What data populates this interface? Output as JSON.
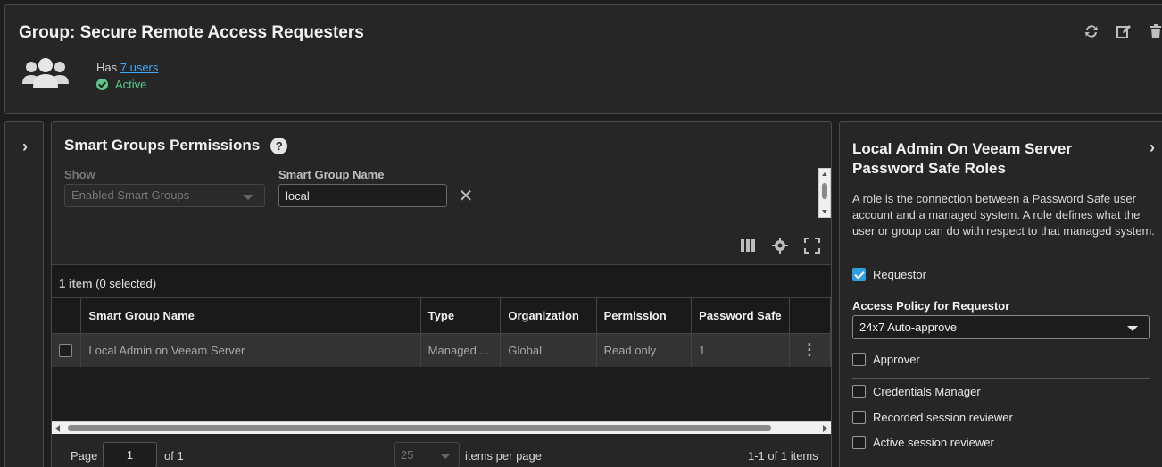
{
  "header": {
    "title": "Group: Secure Remote Access Requesters",
    "has_prefix": "Has",
    "users_link": "7 users",
    "status": "Active",
    "actions": [
      {
        "icon": "refresh-icon"
      },
      {
        "icon": "edit-icon"
      },
      {
        "icon": "trash-icon"
      }
    ]
  },
  "permissions": {
    "title": "Smart Groups Permissions",
    "show_label": "Show",
    "show_value": "Enabled Smart Groups",
    "name_label": "Smart Group Name",
    "name_value": "local",
    "count_bold": "1 item",
    "count_rest": " (0 selected)",
    "columns": [
      "Smart Group Name",
      "Type",
      "Organization",
      "Permission",
      "Password Safe"
    ],
    "rows": [
      {
        "name": "Local Admin on Veeam Server",
        "type": "Managed ...",
        "organization": "Global",
        "permission": "Read only",
        "password_safe": "1"
      }
    ],
    "pager": {
      "page_label": "Page",
      "page_value": "1",
      "of_label": "of 1",
      "per_page_value": "25",
      "per_page_label": "items per page",
      "range": "1-1 of 1 items"
    }
  },
  "roles": {
    "title": "Local Admin On Veeam Server Password Safe Roles",
    "description": "A role is the connection between a Password Safe user account and a managed system. A role defines what the user or group can do with respect to that managed system.",
    "requestor": {
      "label": "Requestor",
      "checked": true
    },
    "access_policy_label": "Access Policy for Requestor",
    "access_policy_value": "24x7 Auto-approve",
    "approver": {
      "label": "Approver",
      "checked": false
    },
    "credentials_manager": {
      "label": "Credentials Manager",
      "checked": false
    },
    "recorded_reviewer": {
      "label": "Recorded session reviewer",
      "checked": false
    },
    "active_reviewer": {
      "label": "Active session reviewer",
      "checked": false
    }
  },
  "colors": {
    "accent": "#3fa9f5",
    "status_green": "#5ec98a",
    "checkbox_blue": "#2e9fe0",
    "background": "#1e1e1e",
    "panel": "#262626"
  }
}
